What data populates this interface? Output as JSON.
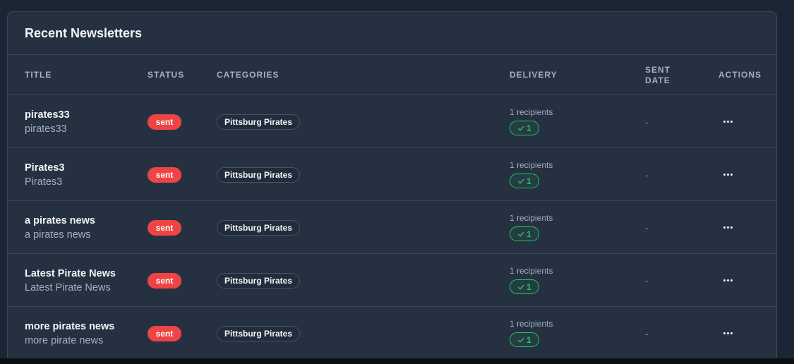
{
  "card_title": "Recent Newsletters",
  "columns": {
    "title": "Title",
    "status": "Status",
    "categories": "Categories",
    "delivery": "Delivery",
    "sent_date": "Sent\nDate",
    "actions": "Actions"
  },
  "rows": [
    {
      "title": "pirates33",
      "subtitle": "pirates33",
      "status": "sent",
      "category": "Pittsburg Pirates",
      "recipients": "1 recipients",
      "delivered": "1",
      "sent_date": "-"
    },
    {
      "title": "Pirates3",
      "subtitle": "Pirates3",
      "status": "sent",
      "category": "Pittsburg Pirates",
      "recipients": "1 recipients",
      "delivered": "1",
      "sent_date": "-"
    },
    {
      "title": "a pirates news",
      "subtitle": "a pirates news",
      "status": "sent",
      "category": "Pittsburg Pirates",
      "recipients": "1 recipients",
      "delivered": "1",
      "sent_date": "-"
    },
    {
      "title": "Latest Pirate News",
      "subtitle": "Latest Pirate News",
      "status": "sent",
      "category": "Pittsburg Pirates",
      "recipients": "1 recipients",
      "delivered": "1",
      "sent_date": "-"
    },
    {
      "title": "more pirates news",
      "subtitle": "more pirate news",
      "status": "sent",
      "category": "Pittsburg Pirates",
      "recipients": "1 recipients",
      "delivered": "1",
      "sent_date": "-"
    }
  ],
  "colors": {
    "page_bg": "#1c2533",
    "card_bg": "#253141",
    "status_sent": "#ef4444",
    "delivered_green": "#22c55e"
  },
  "icons": {
    "delivered": "check-icon",
    "actions": "more-horizontal-icon"
  }
}
